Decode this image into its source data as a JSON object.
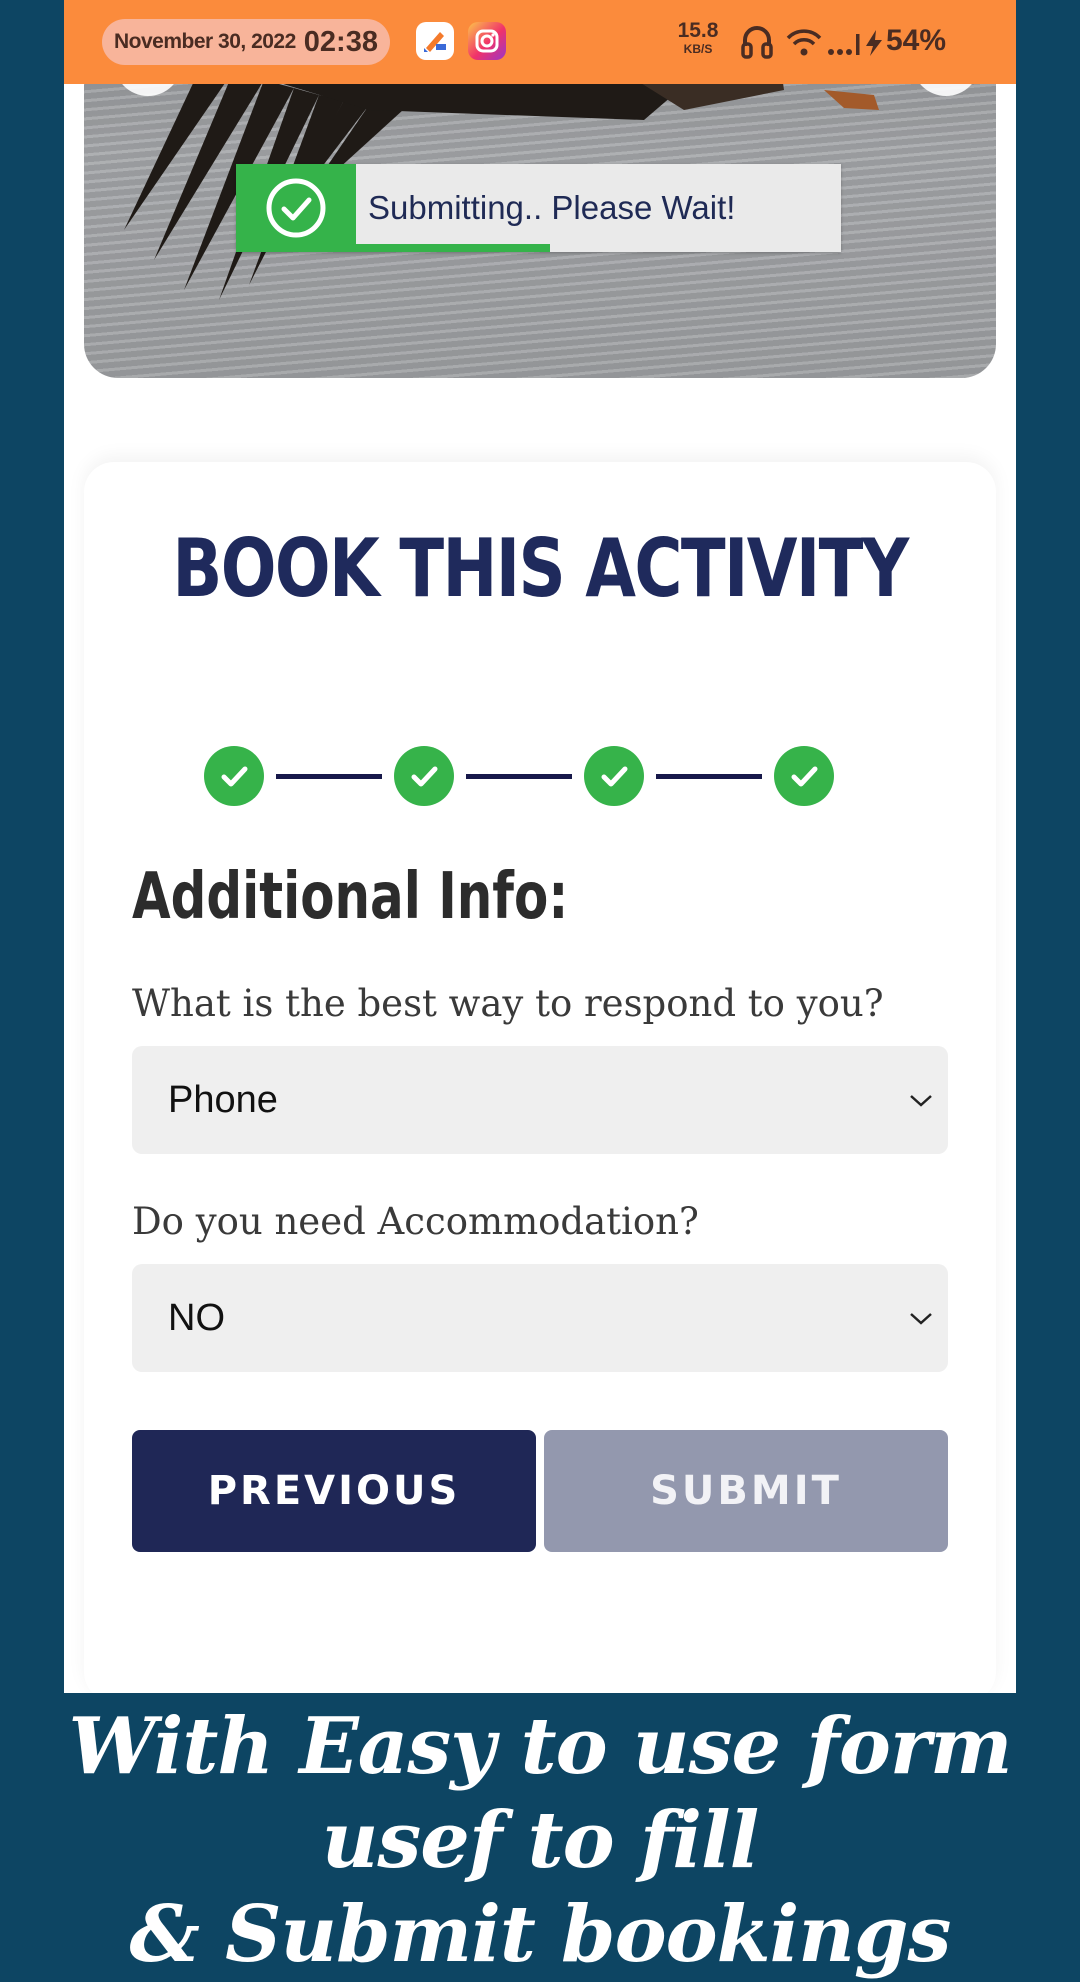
{
  "status_bar": {
    "date": "November 30, 2022",
    "time": "02:38",
    "net_speed": "15.8",
    "net_unit": "KB/S",
    "battery": "54%",
    "app_icons": [
      "pencil-app-icon",
      "instagram-icon"
    ],
    "bg_color": "#fb8b3c"
  },
  "toast": {
    "message": "Submitting.. Please Wait!",
    "progress": 0.4,
    "accent_color": "#35b34a"
  },
  "form": {
    "title": "BOOK THIS ACTIVITY",
    "steps_completed": 4,
    "steps_total": 4,
    "section_title": "Additional Info:",
    "questions": [
      {
        "label": "What is the best way to respond to you?",
        "value": "Phone"
      },
      {
        "label": "Do you need Accommodation?",
        "value": "NO"
      }
    ],
    "buttons": {
      "previous": "PREVIOUS",
      "submit": "SUBMIT"
    }
  },
  "caption": {
    "line1": "With Easy to use form usef to fill",
    "line2": "& Submit bookings"
  },
  "colors": {
    "background": "#0d4563",
    "primary": "#1f2756",
    "success": "#36b34a",
    "disabled": "#9398ae"
  }
}
